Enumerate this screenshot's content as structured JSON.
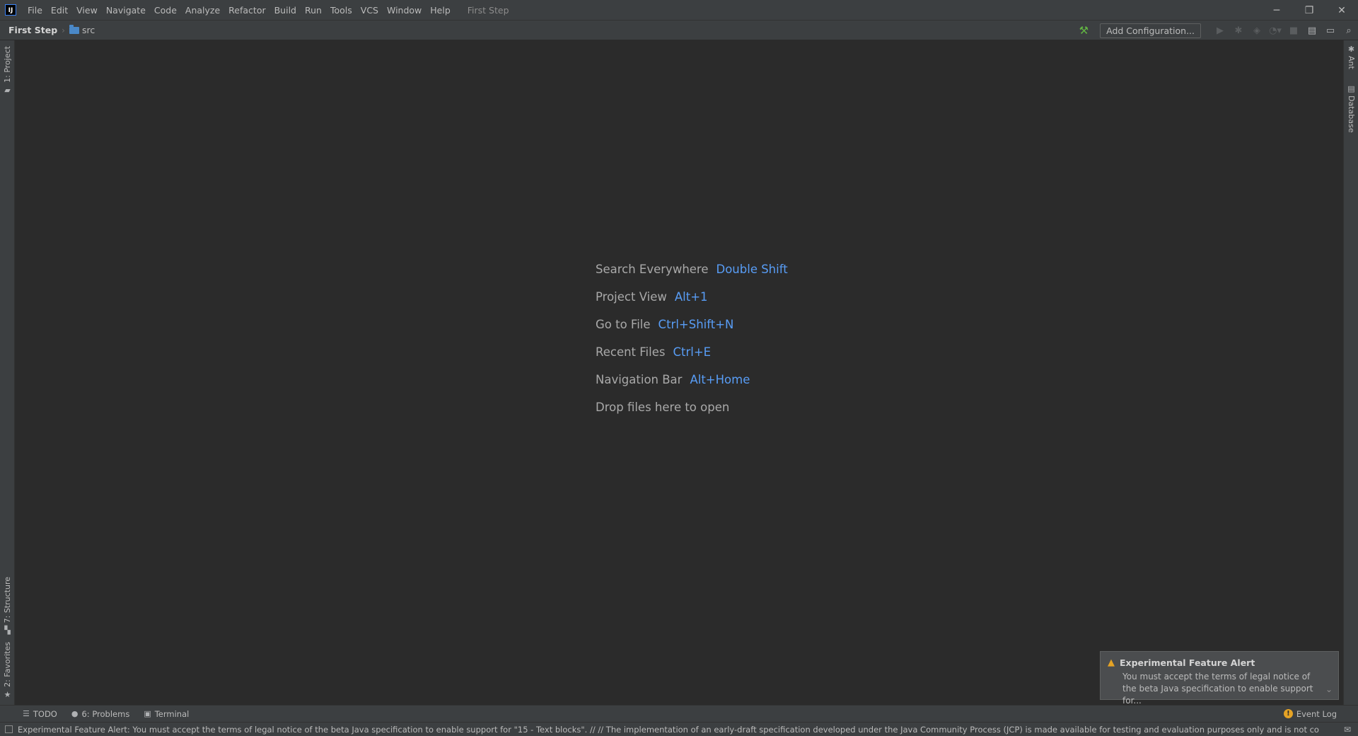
{
  "titlebar": {
    "app_logo": "IJ",
    "menu": [
      "File",
      "Edit",
      "View",
      "Navigate",
      "Code",
      "Analyze",
      "Refactor",
      "Build",
      "Run",
      "Tools",
      "VCS",
      "Window",
      "Help"
    ],
    "window_title": "First Step",
    "controls": {
      "minimize": "─",
      "restore": "❐",
      "close": "✕"
    }
  },
  "navbar": {
    "project": "First Step",
    "folder": "src",
    "add_config": "Add Configuration..."
  },
  "left_stripe": {
    "project_tab": "1: Project",
    "structure_tab": "7: Structure",
    "favorites_tab": "2: Favorites"
  },
  "right_stripe": {
    "ant_tab": "Ant",
    "database_tab": "Database"
  },
  "empty_state": {
    "hints": [
      {
        "label": "Search Everywhere",
        "key": "Double Shift"
      },
      {
        "label": "Project View",
        "key": "Alt+1"
      },
      {
        "label": "Go to File",
        "key": "Ctrl+Shift+N"
      },
      {
        "label": "Recent Files",
        "key": "Ctrl+E"
      },
      {
        "label": "Navigation Bar",
        "key": "Alt+Home"
      }
    ],
    "drop_text": "Drop files here to open"
  },
  "notification": {
    "title": "Experimental Feature Alert",
    "line1": "You must accept the terms of legal notice of",
    "line2": "the beta Java specification to enable support for..."
  },
  "bottom_bar": {
    "todo": "TODO",
    "problems": "6: Problems",
    "terminal": "Terminal",
    "event_log": "Event Log"
  },
  "status_bar": {
    "message": "Experimental Feature Alert: You must accept the terms of legal notice of the beta Java specification to enable support for \"15 - Text blocks\". // // The implementation of an early-draft specification developed under the Java Community Process (JCP) is made available for testing and evaluation purposes only and is not co... (moments ago)"
  },
  "colors": {
    "background": "#2b2b2b",
    "chrome": "#3c3f41",
    "shortcut_accent": "#589df6",
    "warning": "#e5a325",
    "build_green": "#62b543"
  },
  "icons": [
    "hammer-icon",
    "run-icon",
    "debug-icon",
    "coverage-icon",
    "profile-icon",
    "stop-icon",
    "project-structure-icon",
    "layout-icon",
    "search-icon",
    "warning-icon",
    "todo-icon",
    "problems-icon",
    "terminal-icon",
    "event-log-icon",
    "status-icon"
  ]
}
